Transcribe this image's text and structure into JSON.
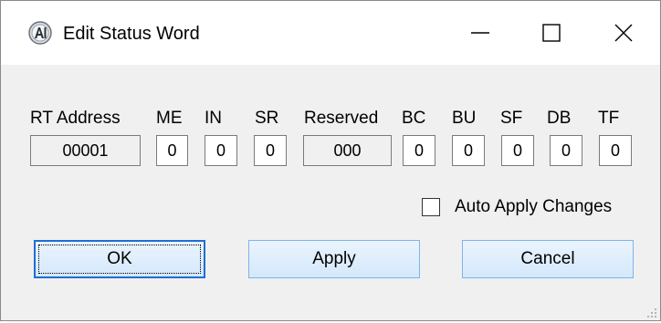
{
  "window": {
    "title": "Edit Status Word",
    "app_icon": "ai-logo-icon",
    "controls": [
      "minimize-icon",
      "maximize-icon",
      "close-icon"
    ]
  },
  "fields": [
    {
      "label": "RT Address",
      "value": "00001"
    },
    {
      "label": "ME",
      "value": "0"
    },
    {
      "label": "IN",
      "value": "0"
    },
    {
      "label": "SR",
      "value": "0"
    },
    {
      "label": "Reserved",
      "value": "000"
    },
    {
      "label": "BC",
      "value": "0"
    },
    {
      "label": "BU",
      "value": "0"
    },
    {
      "label": "SF",
      "value": "0"
    },
    {
      "label": "DB",
      "value": "0"
    },
    {
      "label": "TF",
      "value": "0"
    }
  ],
  "auto_apply": {
    "label": "Auto Apply Changes",
    "checked": false
  },
  "buttons": {
    "ok": "OK",
    "apply": "Apply",
    "cancel": "Cancel"
  },
  "colors": {
    "button_border": "#7eb4ea",
    "default_button_border": "#1e6ed6"
  }
}
